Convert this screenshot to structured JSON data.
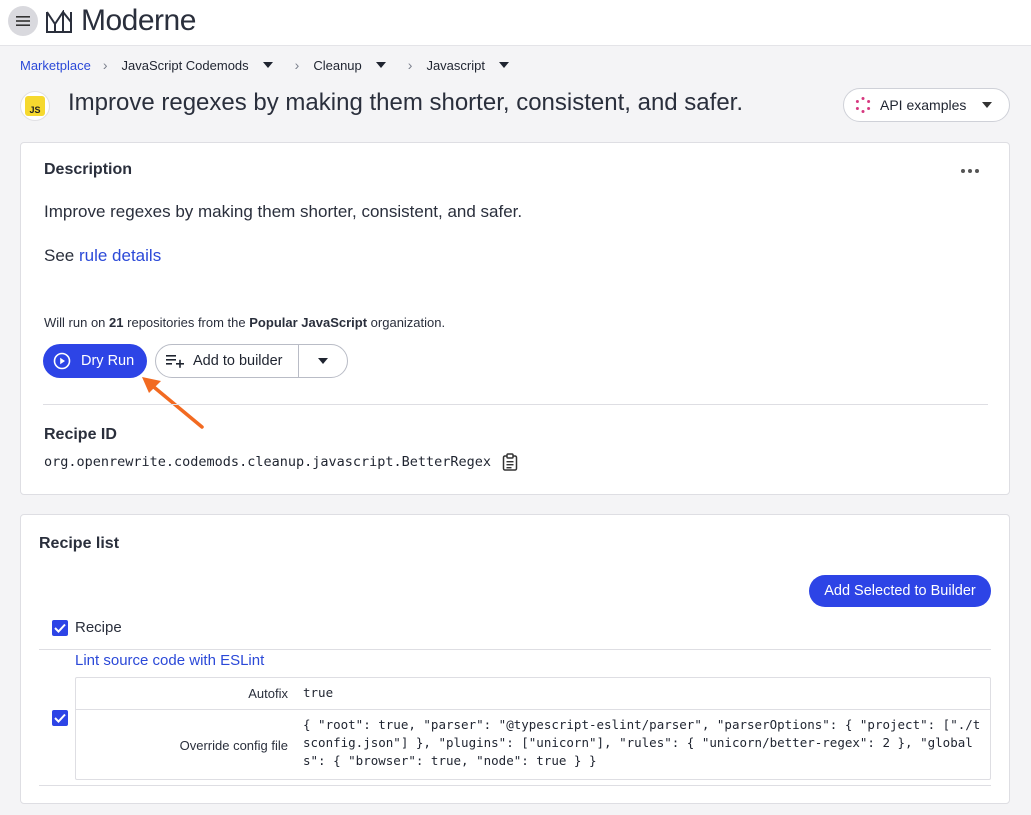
{
  "header": {
    "logo_text": "Moderne"
  },
  "breadcrumb": {
    "items": [
      "Marketplace",
      "JavaScript Codemods",
      "Cleanup",
      "Javascript"
    ]
  },
  "title": {
    "badge": "JS",
    "text": "Improve regexes by making them shorter, consistent, and safer.",
    "api_button": "API examples"
  },
  "description": {
    "heading": "Description",
    "text": "Improve regexes by making them shorter, consistent, and safer.",
    "see_prefix": "See",
    "see_link": "rule details",
    "will_run_prefix": "Will run on",
    "repo_count": "21",
    "will_run_middle": "repositories from the",
    "org_name": "Popular JavaScript",
    "will_run_suffix": "organization.",
    "dry_run_label": "Dry Run",
    "add_builder_label": "Add to builder",
    "recipe_id_heading": "Recipe ID",
    "recipe_id": "org.openrewrite.codemods.cleanup.javascript.BetterRegex"
  },
  "recipe_list": {
    "heading": "Recipe list",
    "add_selected_label": "Add Selected to Builder",
    "column_header": "Recipe",
    "recipe_name": "Lint source code with ESLint",
    "options": [
      {
        "label": "Autofix",
        "value": "true"
      },
      {
        "label": "Override config file",
        "value": "{ \"root\": true, \"parser\": \"@typescript-eslint/parser\", \"parserOptions\": { \"project\": [\"./tsconfig.json\"] }, \"plugins\": [\"unicorn\"], \"rules\": { \"unicorn/better-regex\": 2 }, \"globals\": { \"browser\": true, \"node\": true } }"
      }
    ]
  },
  "colors": {
    "accent": "#2d44e6",
    "link": "#2b49d8",
    "annotation_arrow": "#f26a21",
    "js_badge": "#f6d92f"
  }
}
